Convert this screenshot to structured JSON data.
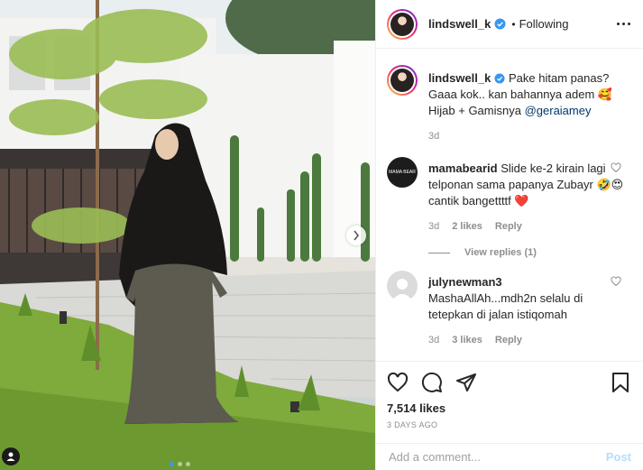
{
  "post": {
    "username": "lindswell_k",
    "separator": "•",
    "follow_status": "Following"
  },
  "caption": {
    "username": "lindswell_k",
    "text_1": "Pake hitam panas? Gaaa kok.. kan bahannya adem 🥰 Hijab + Gamisnya ",
    "mention": "@geraiamey",
    "time": "3d"
  },
  "comments": [
    {
      "username": "mamabearid",
      "text": "Slide ke-2 kirain lagi telponan sama papanya Zubayr 🤣😍 cantik bangettttf ❤️",
      "time": "3d",
      "likes": "2 likes",
      "reply": "Reply",
      "avatar_text": "MAMA BEAR"
    },
    {
      "username": "julynewman3",
      "text": "MashaAllAh...mdh2n selalu di tetepkan di jalan istiqomah",
      "time": "3d",
      "likes": "3 likes",
      "reply": "Reply"
    }
  ],
  "view_replies": "View replies (1)",
  "likes": "7,514 likes",
  "posted_ago": "3 DAYS AGO",
  "add_comment": {
    "placeholder": "Add a comment...",
    "post_label": "Post"
  },
  "colors": {
    "link": "#00376b",
    "verified": "#3897f0",
    "muted": "#8e8e8e",
    "post_disabled": "#b2dffc"
  }
}
